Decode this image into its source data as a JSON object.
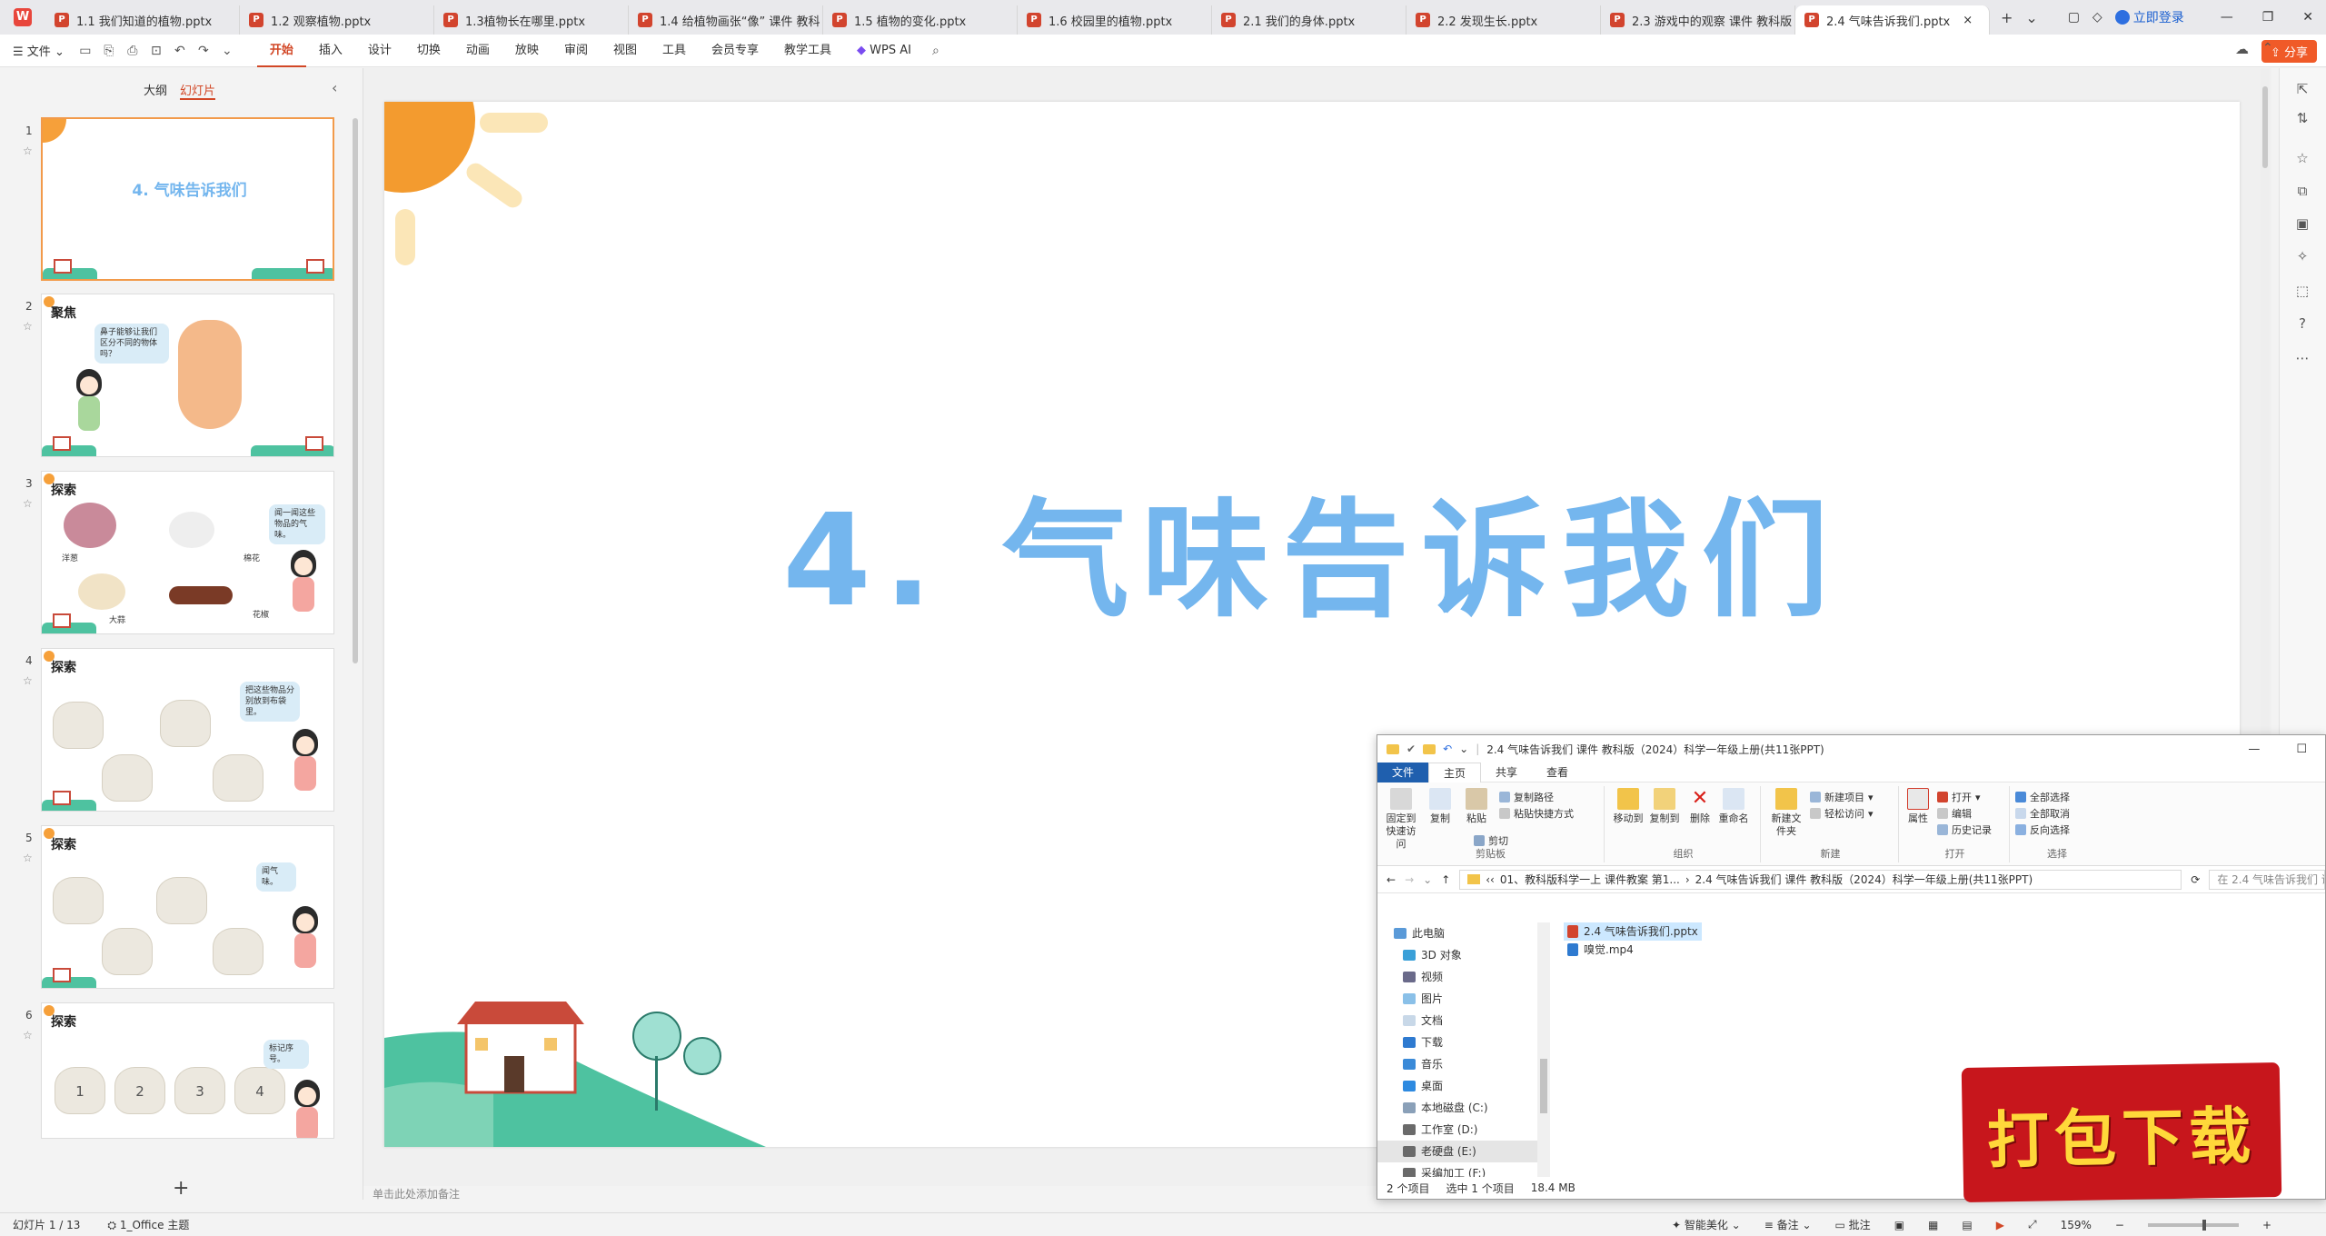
{
  "tabs": [
    {
      "label": "1.1 我们知道的植物.pptx"
    },
    {
      "label": "1.2 观察植物.pptx"
    },
    {
      "label": "1.3植物长在哪里.pptx"
    },
    {
      "label": "1.4 给植物画张“像” 课件 教科"
    },
    {
      "label": "1.5 植物的变化.pptx"
    },
    {
      "label": "1.6 校园里的植物.pptx"
    },
    {
      "label": "2.1 我们的身体.pptx"
    },
    {
      "label": "2.2 发现生长.pptx"
    },
    {
      "label": "2.3 游戏中的观察  课件 教科版"
    },
    {
      "label": "2.4 气味告诉我们.pptx"
    }
  ],
  "window": {
    "login_label": "立即登录",
    "share_label": "分享"
  },
  "ribbon": {
    "file_menu": "文件",
    "tabs": [
      "开始",
      "插入",
      "设计",
      "切换",
      "动画",
      "放映",
      "审阅",
      "视图",
      "工具",
      "会员专享",
      "教学工具"
    ],
    "active_tab": "开始",
    "wps_ai": "WPS AI"
  },
  "left_panel": {
    "outline_tab": "大纲",
    "slides_tab": "幻灯片"
  },
  "slides": [
    {
      "num": "1",
      "title": "4. 气味告诉我们"
    },
    {
      "num": "2",
      "heading": "聚焦",
      "bubble": "鼻子能够让我们区分不同的物体吗？"
    },
    {
      "num": "3",
      "heading": "探索",
      "bubble": "闻一闻这些物品的气味。",
      "labels": [
        "洋葱",
        "棉花",
        "大蒜",
        "花椒"
      ]
    },
    {
      "num": "4",
      "heading": "探索",
      "bubble": "把这些物品分别放到布袋里。"
    },
    {
      "num": "5",
      "heading": "探索",
      "bubble": "闻气味。"
    },
    {
      "num": "6",
      "heading": "探索",
      "bubble": "标记序号。",
      "bag_numbers": [
        "1",
        "2",
        "3",
        "4"
      ]
    }
  ],
  "main_slide": {
    "title": "4. 气味告诉我们"
  },
  "notes_placeholder": "单击此处添加备注",
  "explorer": {
    "title": "2.4 气味告诉我们  课件 教科版（2024）科学一年级上册(共11张PPT)",
    "tabs": [
      "文件",
      "主页",
      "共享",
      "查看"
    ],
    "groups": {
      "clipboard": {
        "label": "剪贴板",
        "pin": "固定到快速访问",
        "copy": "复制",
        "paste": "粘贴",
        "copy_path": "复制路径",
        "paste_shortcut": "粘贴快捷方式",
        "cut": "剪切"
      },
      "organize": {
        "label": "组织",
        "move_to": "移动到",
        "copy_to": "复制到",
        "delete": "删除",
        "rename": "重命名"
      },
      "new": {
        "label": "新建",
        "new_folder": "新建文件夹",
        "new_item": "新建项目",
        "easy_access": "轻松访问"
      },
      "open": {
        "label": "打开",
        "properties": "属性",
        "open": "打开",
        "edit": "编辑",
        "history": "历史记录"
      },
      "select": {
        "label": "选择",
        "select_all": "全部选择",
        "select_none": "全部取消",
        "invert": "反向选择"
      }
    },
    "address": {
      "part1": "01、教科版科学一上 课件教案 第1...",
      "part2": "2.4 气味告诉我们  课件 教科版（2024）科学一年级上册(共11张PPT)"
    },
    "search_placeholder": "在 2.4 气味告诉我们  课件 教科版...",
    "nav": [
      "此电脑",
      "3D 对象",
      "视频",
      "图片",
      "文档",
      "下载",
      "音乐",
      "桌面",
      "本地磁盘 (C:)",
      "工作室 (D:)",
      "老硬盘 (E:)",
      "采编加工 (F:)"
    ],
    "files": [
      {
        "name": "2.4 气味告诉我们.pptx",
        "type": "pptx"
      },
      {
        "name": "嗅觉.mp4",
        "type": "video"
      }
    ],
    "status": {
      "count": "2 个项目",
      "selected": "选中 1 个项目",
      "size": "18.4 MB"
    }
  },
  "promo": {
    "text": "打包下载"
  },
  "statusbar": {
    "slide_info": "幻灯片 1 / 13",
    "theme": "1_Office 主题",
    "smart": "智能美化",
    "notes": "备注",
    "comments": "批注",
    "zoom": "159%"
  },
  "colors": {
    "accent": "#d24726",
    "title_blue": "#74b6ee",
    "promo_red": "#c7161c",
    "promo_yellow": "#ffd83a"
  }
}
